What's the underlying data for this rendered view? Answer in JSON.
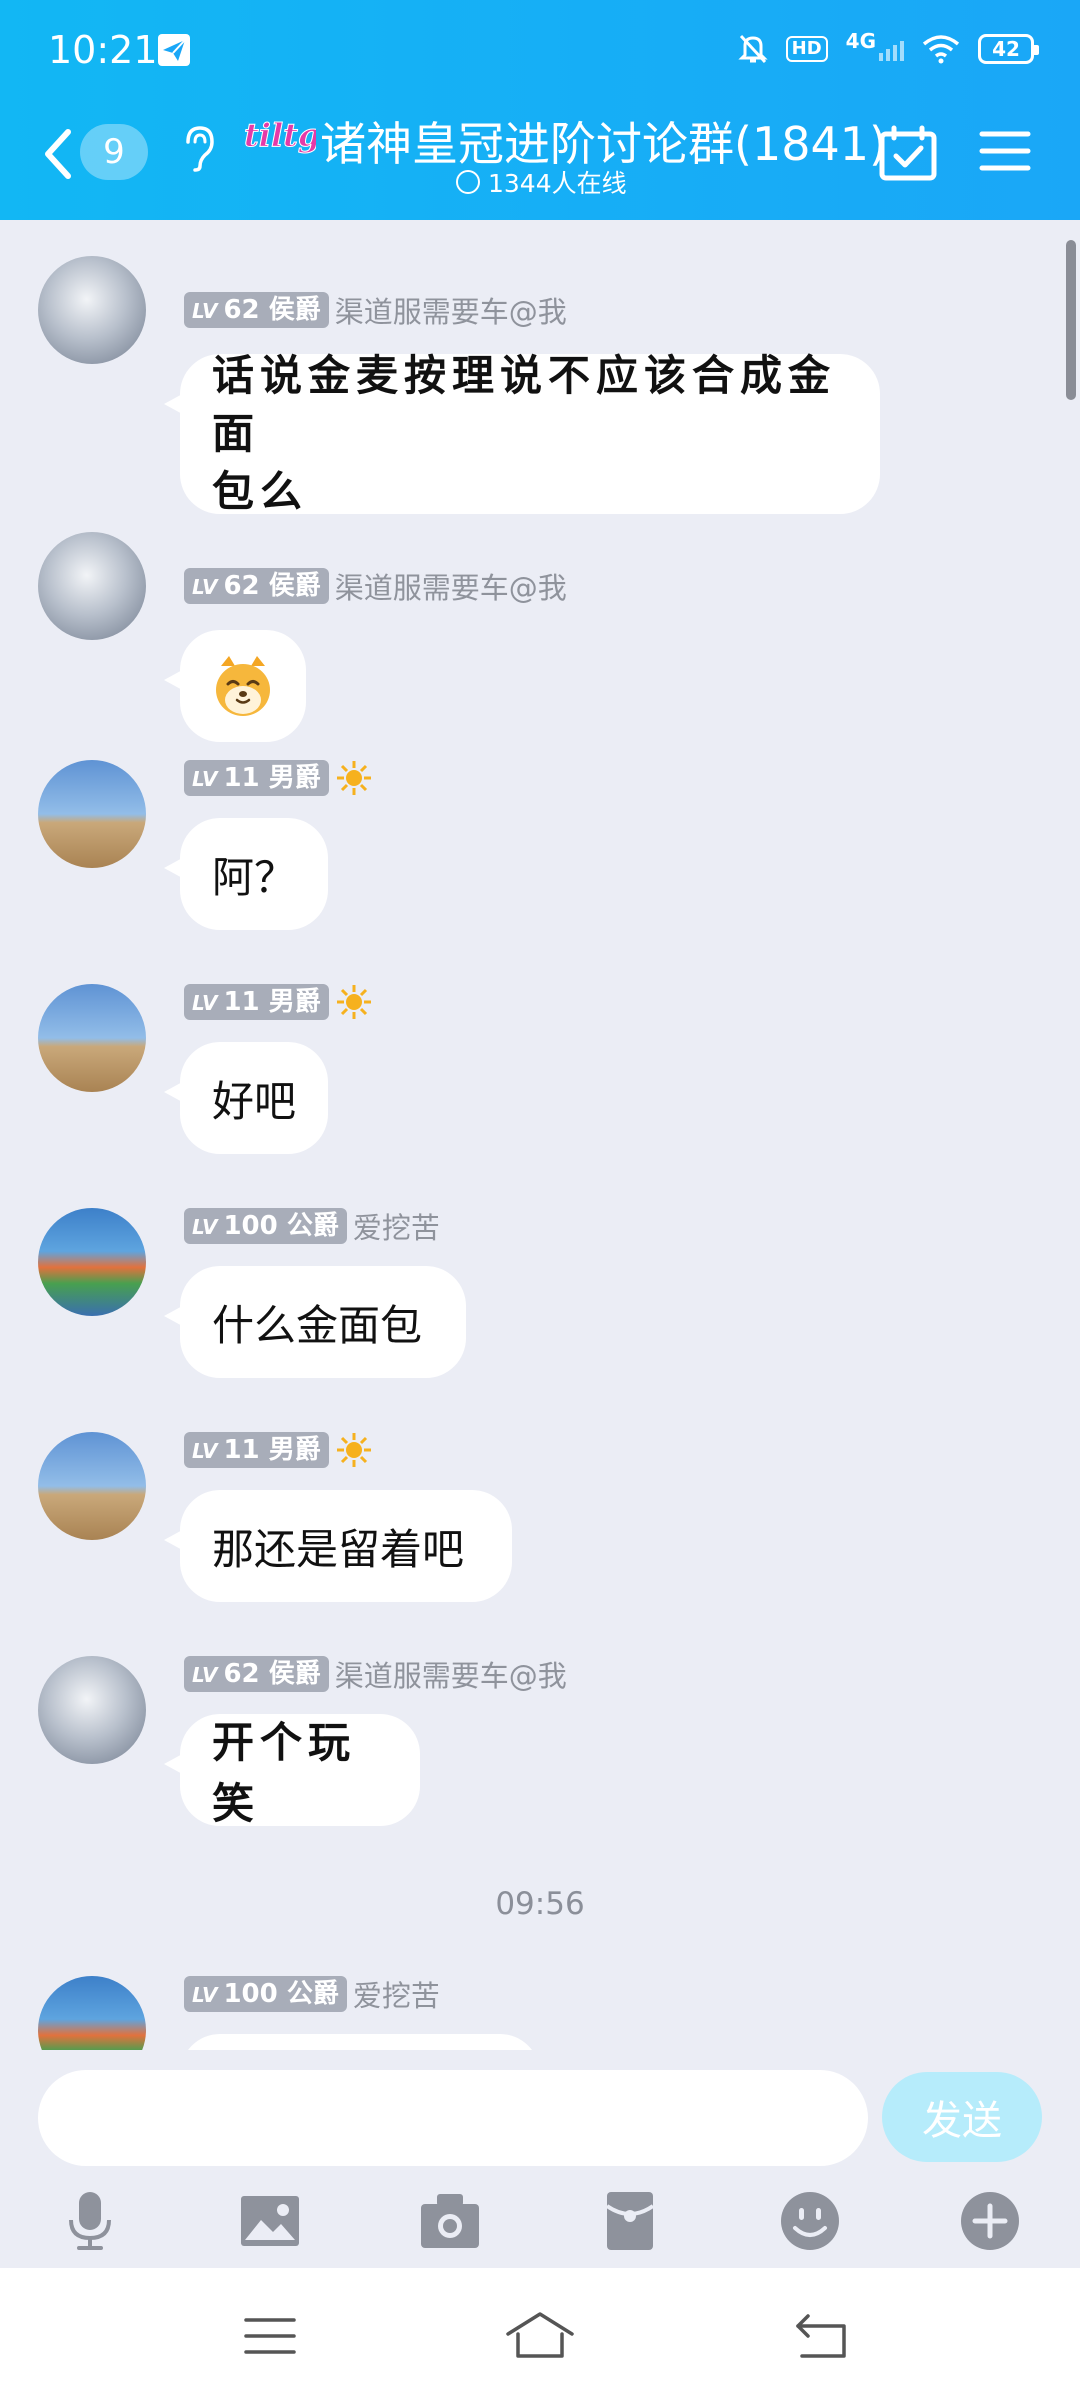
{
  "status_bar": {
    "time": "10:21",
    "hd": "HD",
    "network": "4G",
    "battery": "42"
  },
  "header": {
    "unread_count": "9",
    "logo_text": "tiltg",
    "title": "诸神皇冠进阶讨论群(1841)",
    "online": "1344人在线"
  },
  "messages": [
    {
      "level": "62",
      "rank": "侯爵",
      "nick": "渠道服需要车@我",
      "text": "话说金麦按理说不应该合成金面",
      "text2": "包么"
    },
    {
      "level": "62",
      "rank": "侯爵",
      "nick": "渠道服需要车@我",
      "sticker": "hamster-emoji"
    },
    {
      "level": "11",
      "rank": "男爵",
      "nick": "",
      "text": "阿？"
    },
    {
      "level": "11",
      "rank": "男爵",
      "nick": "",
      "text": "好吧"
    },
    {
      "level": "100",
      "rank": "公爵",
      "nick": "爱挖苦",
      "text": "什么金面包"
    },
    {
      "level": "11",
      "rank": "男爵",
      "nick": "",
      "text": "那还是留着吧"
    },
    {
      "level": "62",
      "rank": "侯爵",
      "nick": "渠道服需要车@我",
      "text": "开个玩笑"
    },
    {
      "level": "100",
      "rank": "公爵",
      "nick": "爱挖苦"
    }
  ],
  "lv_prefix": "LV",
  "timestamp": "09:56",
  "input": {
    "placeholder": "",
    "send_label": "发送"
  },
  "toolbar_icons": [
    "microphone-icon",
    "image-icon",
    "camera-icon",
    "red-packet-icon",
    "emoji-icon",
    "plus-icon"
  ],
  "colors": {
    "header": "#1aa7f7",
    "background": "#ebedf5",
    "send_disabled": "#b6ecfb",
    "level_badge": "#a8adb9"
  }
}
